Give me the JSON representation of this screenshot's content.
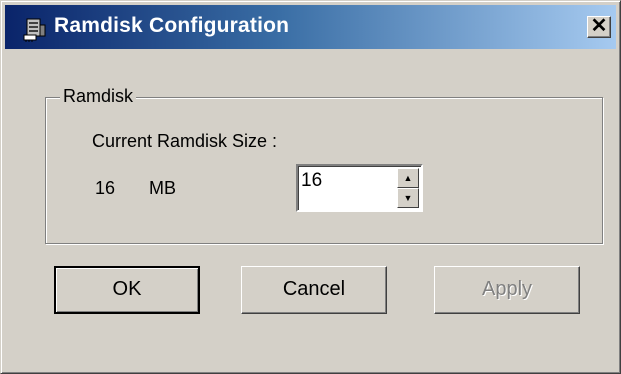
{
  "window": {
    "title": "Ramdisk Configuration",
    "app_icon": "ramdisk-app-icon",
    "close_glyph": "✕",
    "colors": {
      "title_gradient_start": "#0a246a",
      "title_gradient_end": "#a6caf0",
      "face": "#d4d0c8"
    }
  },
  "group": {
    "legend": "Ramdisk",
    "current_size_label": "Current Ramdisk Size :",
    "current_size_value": "16",
    "current_size_unit": "MB",
    "size_input": {
      "value": "16",
      "up_glyph": "▲",
      "down_glyph": "▼"
    }
  },
  "buttons": {
    "ok": "OK",
    "cancel": "Cancel",
    "apply": "Apply"
  }
}
